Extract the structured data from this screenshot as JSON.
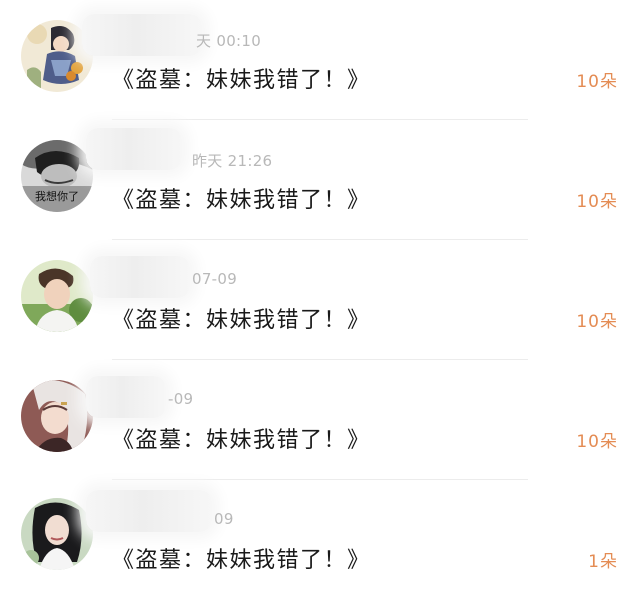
{
  "rows": [
    {
      "time": "天 00:10",
      "message": "《盗墓：妹妹我错了！》",
      "count": "10朵",
      "avatar_icon": "avatar-illustrated-girl"
    },
    {
      "time": "昨天 21:26",
      "message": "《盗墓：妹妹我错了！》",
      "count": "10朵",
      "avatar_icon": "avatar-bw-boy",
      "avatar_text": "我想你了"
    },
    {
      "time": "07-09",
      "message": "《盗墓：妹妹我错了！》",
      "count": "10朵",
      "avatar_icon": "avatar-young-man"
    },
    {
      "time": "-09",
      "message": "《盗墓：妹妹我错了！》",
      "count": "10朵",
      "avatar_icon": "avatar-anime-girl"
    },
    {
      "time": "09",
      "message": "《盗墓：妹妹我错了！》",
      "count": "1朵",
      "avatar_icon": "avatar-woman-portrait"
    }
  ],
  "colors": {
    "count_accent": "#e48c54",
    "time_gray": "#b8b8b8",
    "message_text": "#1a1a1a",
    "divider": "#ececec"
  }
}
